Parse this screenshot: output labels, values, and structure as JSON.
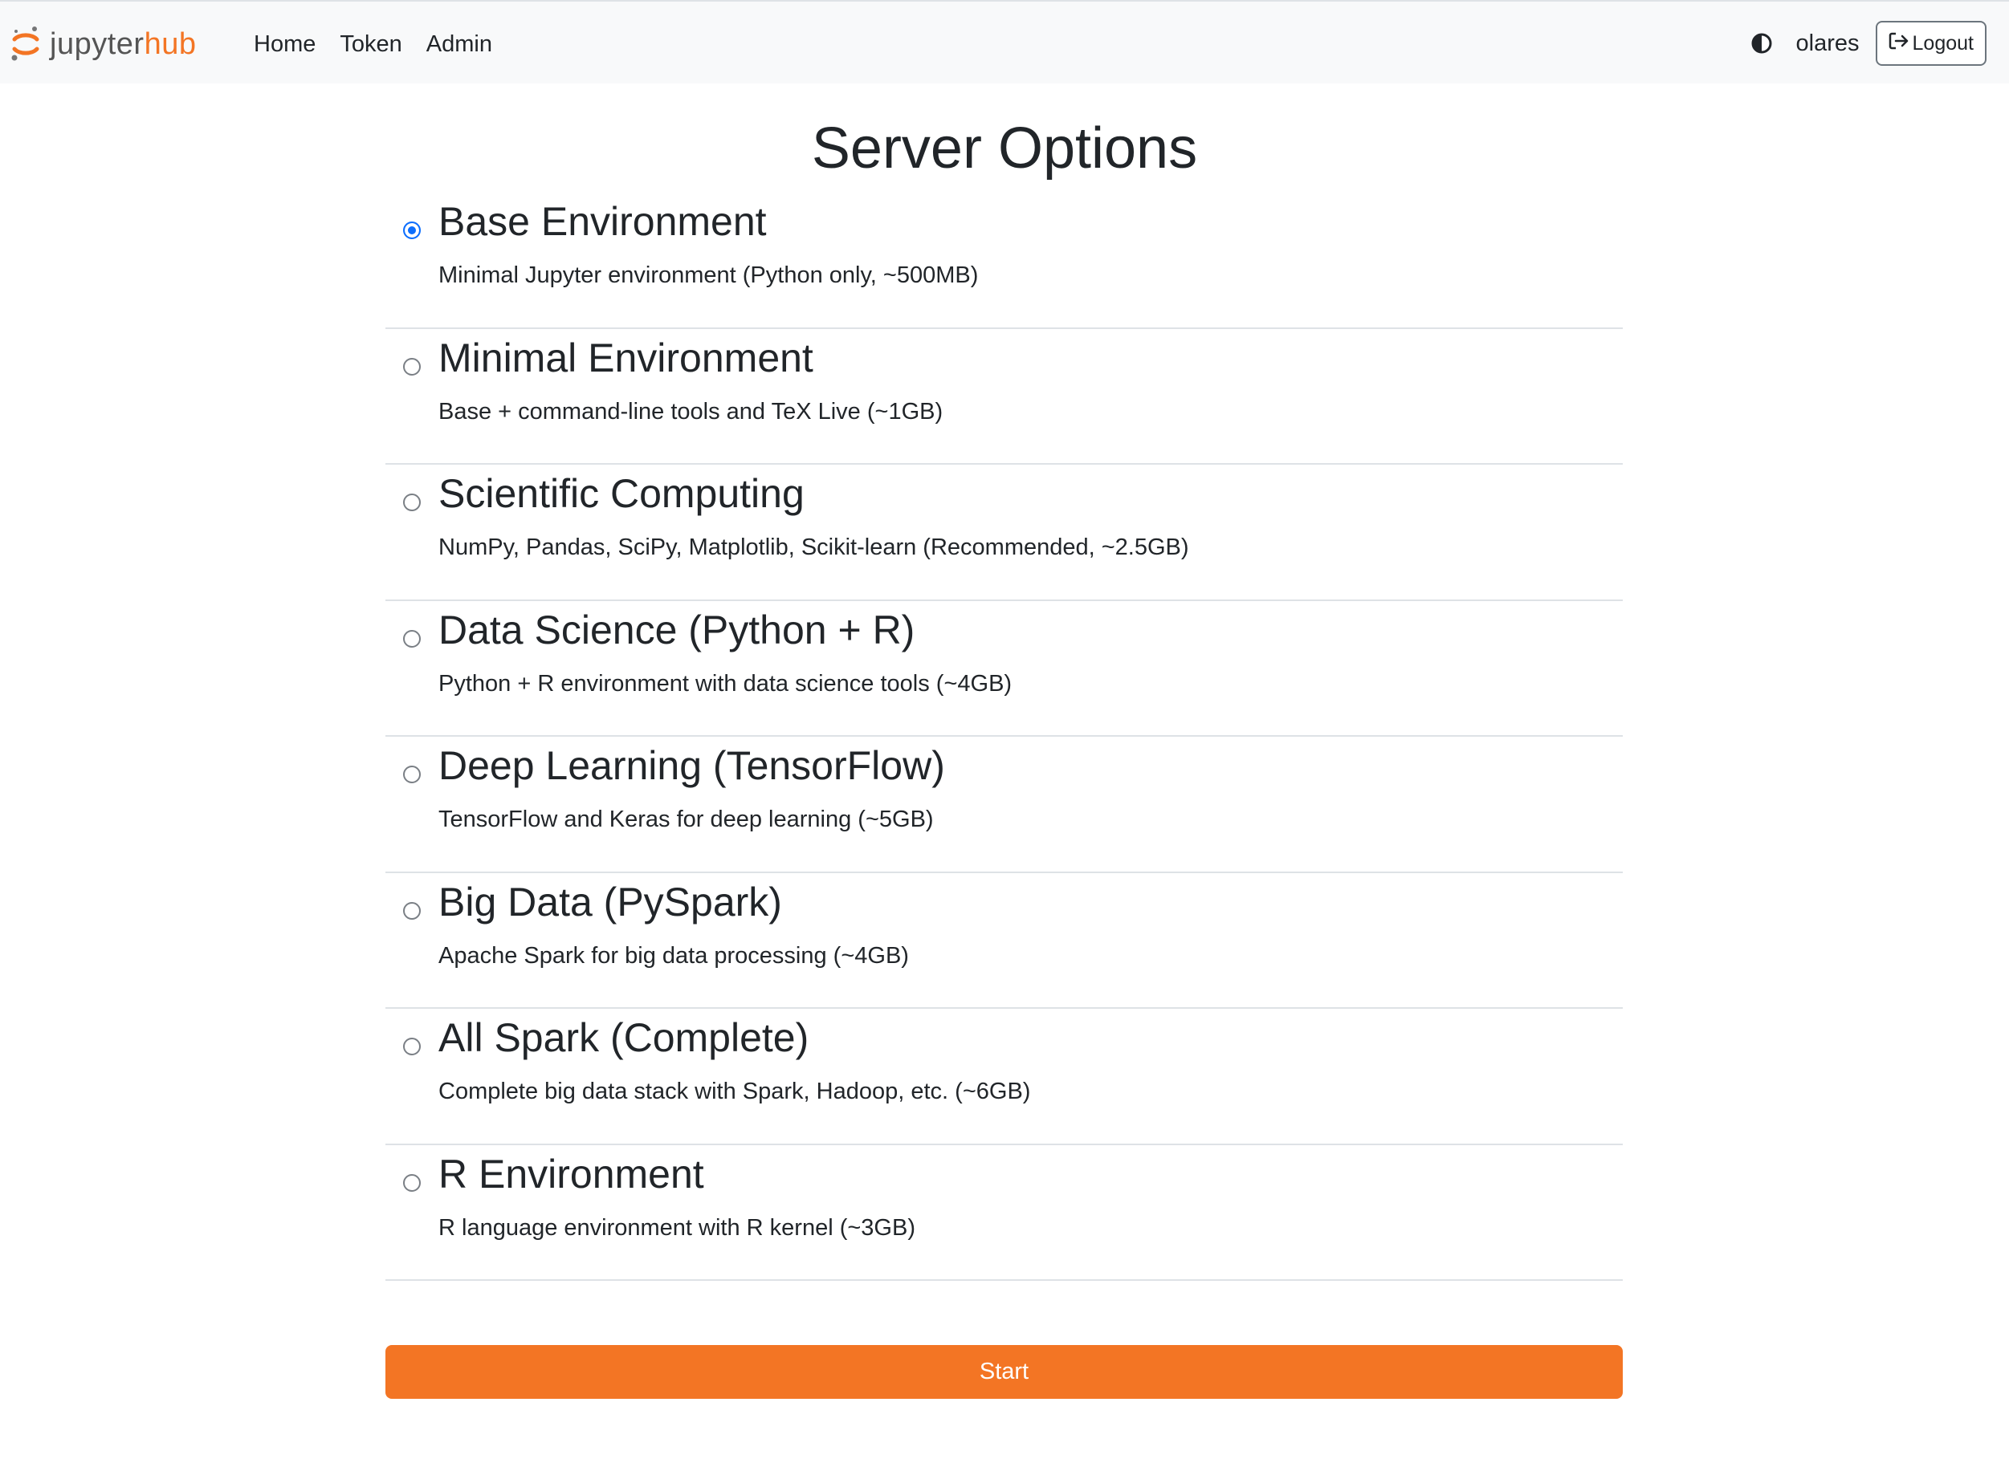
{
  "brand": {
    "part1": "jupyter",
    "part2": "hub",
    "logo_icon": "jupyter-logo-icon",
    "accent_color": "#f37524"
  },
  "nav": {
    "links": [
      "Home",
      "Token",
      "Admin"
    ]
  },
  "user": {
    "theme_icon": "half-circle-theme-icon",
    "name": "olares",
    "logout_label": "Logout",
    "logout_icon": "sign-out-icon"
  },
  "page": {
    "title": "Server Options"
  },
  "options": [
    {
      "title": "Base Environment",
      "desc": "Minimal Jupyter environment (Python only, ~500MB)",
      "selected": true
    },
    {
      "title": "Minimal Environment",
      "desc": "Base + command-line tools and TeX Live (~1GB)",
      "selected": false
    },
    {
      "title": "Scientific Computing",
      "desc": "NumPy, Pandas, SciPy, Matplotlib, Scikit-learn (Recommended, ~2.5GB)",
      "selected": false
    },
    {
      "title": "Data Science (Python + R)",
      "desc": "Python + R environment with data science tools (~4GB)",
      "selected": false
    },
    {
      "title": "Deep Learning (TensorFlow)",
      "desc": "TensorFlow and Keras for deep learning (~5GB)",
      "selected": false
    },
    {
      "title": "Big Data (PySpark)",
      "desc": "Apache Spark for big data processing (~4GB)",
      "selected": false
    },
    {
      "title": "All Spark (Complete)",
      "desc": "Complete big data stack with Spark, Hadoop, etc. (~6GB)",
      "selected": false
    },
    {
      "title": "R Environment",
      "desc": "R language environment with R kernel (~3GB)",
      "selected": false
    }
  ],
  "start": {
    "label": "Start",
    "color": "#f37524"
  },
  "colors": {
    "radio_selected": "#0d6efd",
    "navbar_bg": "#f8f9fa"
  }
}
